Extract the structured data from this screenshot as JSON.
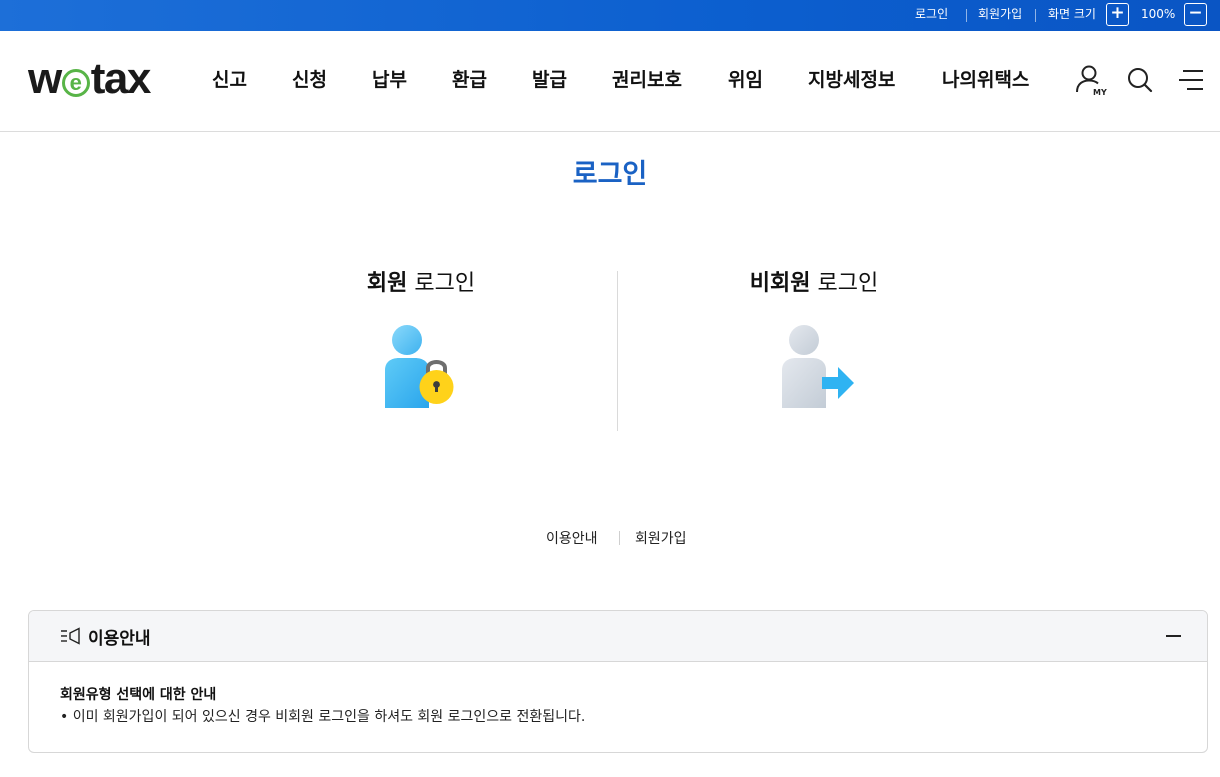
{
  "topbar": {
    "login": "로그인",
    "signup": "회원가입",
    "screen_size_label": "화면 크기",
    "zoom_in": "+",
    "zoom_level": "100%",
    "zoom_out": "−"
  },
  "header": {
    "logo_left": "w",
    "logo_e": "e",
    "logo_right": "tax",
    "nav": [
      "신고",
      "신청",
      "납부",
      "환급",
      "발급",
      "권리보호",
      "위임",
      "지방세정보",
      "나의위택스"
    ],
    "my_label": "MY"
  },
  "main": {
    "title": "로그인",
    "member": {
      "bold": "회원",
      "light": " 로그인"
    },
    "guest": {
      "bold": "비회원",
      "light": " 로그인"
    },
    "links": {
      "guide": "이용안내",
      "signup": "회원가입"
    }
  },
  "info": {
    "title": "이용안내",
    "subtitle": "회원유형 선택에 대한 안내",
    "lines": [
      "• 이미 회원가입이 되어 있으신 경우 비회원 로그인을 하셔도 회원 로그인으로 전환됩니다."
    ]
  },
  "colors": {
    "topbar": "#0c5fcf",
    "title_blue": "#1a62c4",
    "logo_green": "#58b447",
    "lock_yellow": "#ffd21a",
    "arrow_blue": "#2fb3f2"
  }
}
